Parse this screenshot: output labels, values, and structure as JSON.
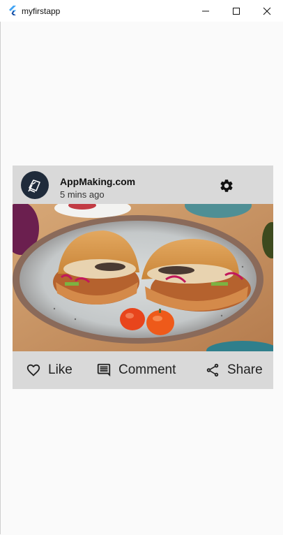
{
  "window": {
    "title": "myfirstapp",
    "controls": [
      "minimize-icon",
      "maximize-icon",
      "close-icon"
    ]
  },
  "post": {
    "author": "AppMaking.com",
    "time": "5 mins ago",
    "avatar_icon": "cards-logo-icon",
    "settings_icon": "gear-icon",
    "image_alt": "sandwich"
  },
  "actions": {
    "like": {
      "label": "Like",
      "icon": "heart-outline-icon"
    },
    "comment": {
      "label": "Comment",
      "icon": "comment-icon"
    },
    "share": {
      "label": "Share",
      "icon": "share-icon"
    }
  },
  "colors": {
    "card_background": "#d9d9d9",
    "avatar_background": "#1f2b3b",
    "page_background": "#fafafa"
  }
}
